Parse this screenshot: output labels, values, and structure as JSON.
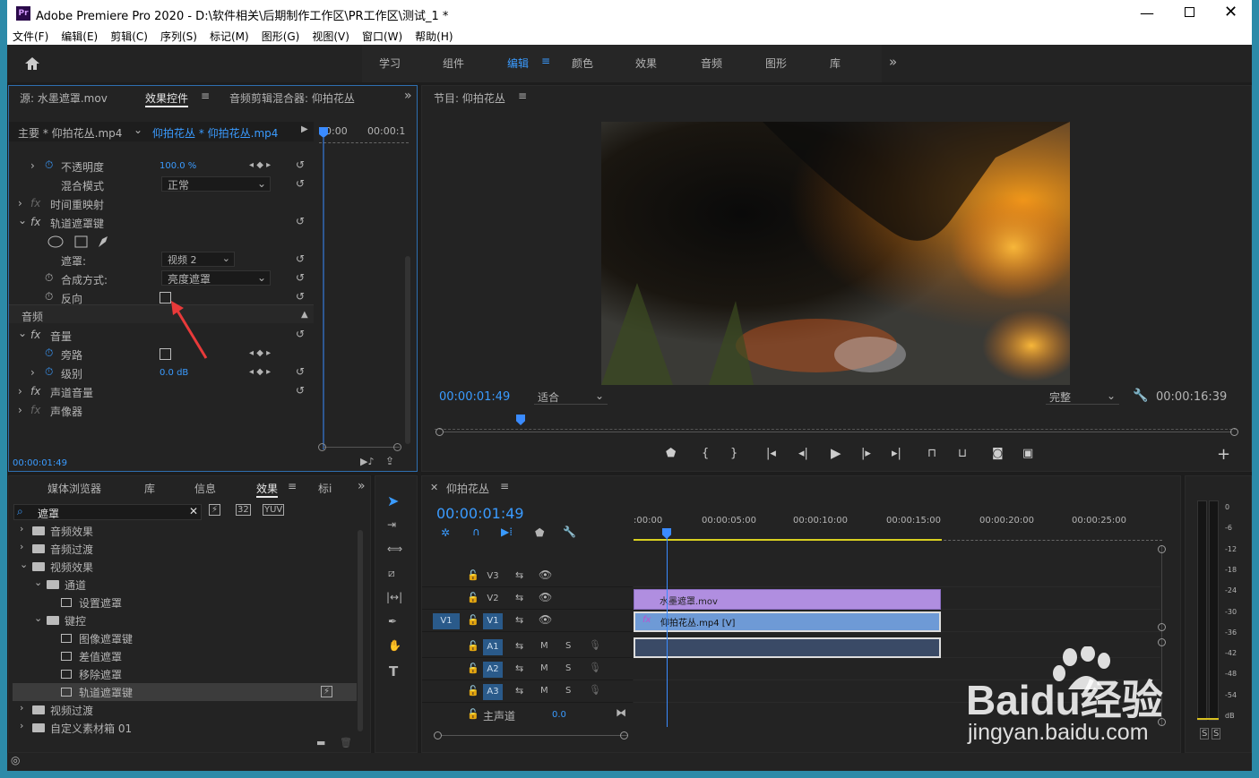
{
  "window": {
    "title": "Adobe Premiere Pro 2020 - D:\\软件相关\\后期制作工作区\\PR工作区\\测试_1 *",
    "app_icon": "Pr"
  },
  "menu": [
    "文件(F)",
    "编辑(E)",
    "剪辑(C)",
    "序列(S)",
    "标记(M)",
    "图形(G)",
    "视图(V)",
    "窗口(W)",
    "帮助(H)"
  ],
  "workspaces": [
    "学习",
    "组件",
    "编辑",
    "颜色",
    "效果",
    "音频",
    "图形",
    "库"
  ],
  "workspace_active": "编辑",
  "source_panel": {
    "tabs": [
      "源: 水墨遮罩.mov",
      "效果控件",
      "音频剪辑混合器: 仰拍花丛"
    ],
    "clip_master": "主要 * 仰拍花丛.mp4",
    "clip_seq": "仰拍花丛 * 仰拍花丛.mp4",
    "tc_start": "00:00",
    "tc_end": "00:00:1",
    "props": {
      "opacity": "不透明度",
      "opacity_val": "100.0 %",
      "blend": "混合模式",
      "blend_val": "正常",
      "time_remap": "时间重映射",
      "track_matte": "轨道遮罩键",
      "matte": "遮罩:",
      "matte_val": "视频 2",
      "composite": "合成方式:",
      "composite_val": "亮度遮罩",
      "reverse": "反向",
      "audio": "音频",
      "volume": "音量",
      "bypass": "旁路",
      "level": "级别",
      "level_val": "0.0 dB",
      "channel_vol": "声道音量",
      "panner": "声像器"
    },
    "timecode": "00:00:01:49"
  },
  "program": {
    "title": "节目: 仰拍花丛",
    "timecode": "00:00:01:49",
    "fit": "适合",
    "quality": "完整",
    "duration": "00:00:16:39"
  },
  "effects": {
    "tabs": [
      "媒体浏览器",
      "库",
      "信息",
      "效果",
      "标i"
    ],
    "search": "遮罩",
    "items": [
      {
        "label": "音频效果",
        "level": 0,
        "type": "folder",
        "open": false
      },
      {
        "label": "音频过渡",
        "level": 0,
        "type": "folder",
        "open": false
      },
      {
        "label": "视频效果",
        "level": 0,
        "type": "folder",
        "open": true
      },
      {
        "label": "通道",
        "level": 1,
        "type": "folder",
        "open": true
      },
      {
        "label": "设置遮罩",
        "level": 2,
        "type": "fx"
      },
      {
        "label": "键控",
        "level": 1,
        "type": "folder",
        "open": true
      },
      {
        "label": "图像遮罩键",
        "level": 2,
        "type": "fx"
      },
      {
        "label": "差值遮罩",
        "level": 2,
        "type": "fx"
      },
      {
        "label": "移除遮罩",
        "level": 2,
        "type": "fx"
      },
      {
        "label": "轨道遮罩键",
        "level": 2,
        "type": "fx",
        "selected": true
      },
      {
        "label": "视频过渡",
        "level": 0,
        "type": "folder",
        "open": false
      },
      {
        "label": "自定义素材箱 01",
        "level": 0,
        "type": "folder",
        "open": false
      }
    ]
  },
  "timeline": {
    "title": "仰拍花丛",
    "timecode": "00:00:01:49",
    "ruler": [
      ":00:00",
      "00:00:05:00",
      "00:00:10:00",
      "00:00:15:00",
      "00:00:20:00",
      "00:00:25:00"
    ],
    "video_tracks": [
      "V3",
      "V2",
      "V1"
    ],
    "audio_tracks": [
      "A1",
      "A2",
      "A3"
    ],
    "master": "主声道",
    "master_val": "0.0",
    "clips": {
      "v2": "水墨遮罩.mov",
      "v1": "仰拍花丛.mp4 [V]"
    },
    "source_patch": "V1",
    "mute": "M",
    "solo": "S"
  },
  "meter": {
    "scale": [
      "0",
      "-6",
      "-12",
      "-18",
      "-24",
      "-30",
      "-36",
      "-42",
      "-48",
      "-54",
      "dB"
    ],
    "solo": [
      "S",
      "S"
    ]
  },
  "watermark": {
    "brand": "Baidu经验",
    "url": "jingyan.baidu.com"
  }
}
